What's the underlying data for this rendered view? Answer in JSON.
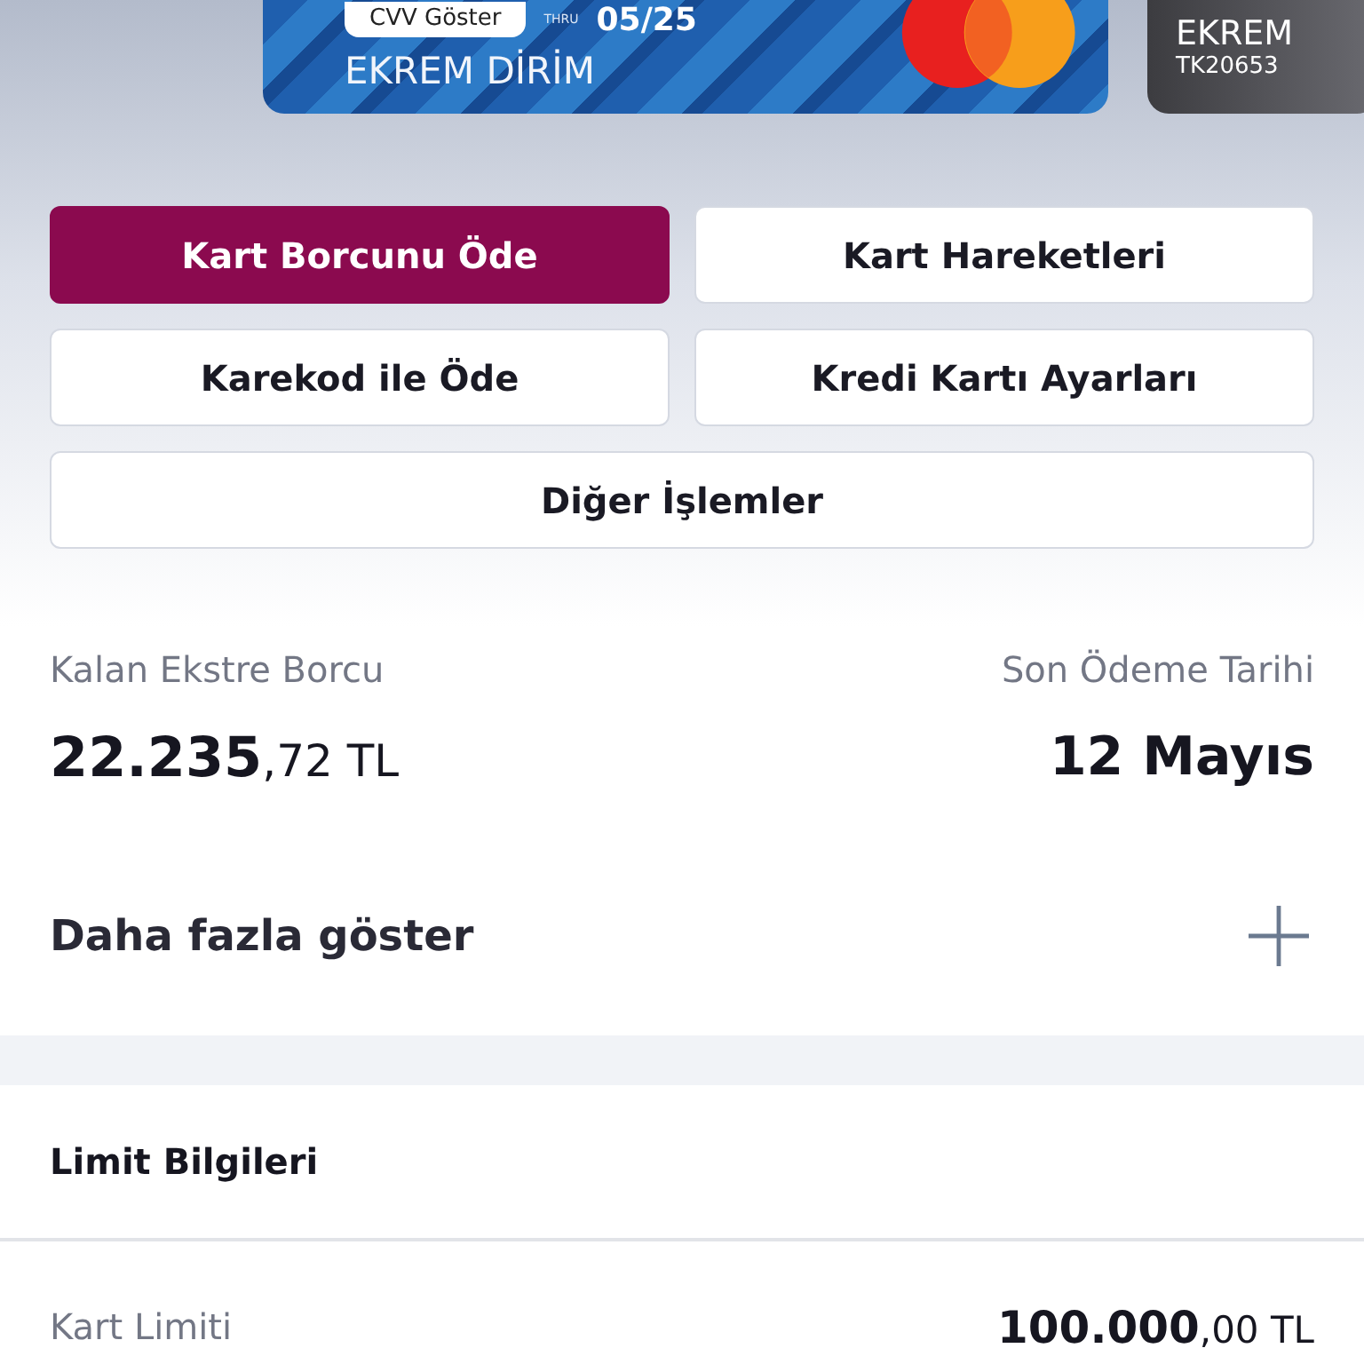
{
  "cards": [
    {
      "kind": "mastercard",
      "cvv_button": "CVV Göster",
      "thru_label": "THRU",
      "expiry": "05/25",
      "holder": "EKREM DİRİM"
    },
    {
      "kind": "dark",
      "holder": "EKREM",
      "number": "TK20653"
    }
  ],
  "actions": [
    {
      "label": "Kart Borcunu Öde",
      "selected": true
    },
    {
      "label": "Kart Hareketleri",
      "selected": false
    },
    {
      "label": "Karekod ile Öde",
      "selected": false
    },
    {
      "label": "Kredi Kartı Ayarları",
      "selected": false
    },
    {
      "label": "Diğer İşlemler",
      "selected": false
    }
  ],
  "statement": {
    "debt_label": "Kalan Ekstre Borcu",
    "debt_value": "**22.235**,72 TL",
    "due_label": "Son Ödeme Tarihi",
    "due_value": "12 Mayıs"
  },
  "more": {
    "label": "Daha fazla göster"
  },
  "limits": {
    "title": "Limit Bilgileri",
    "rows": [
      {
        "label": "Kart Limiti",
        "value": "**100.000**,00 TL"
      }
    ]
  }
}
